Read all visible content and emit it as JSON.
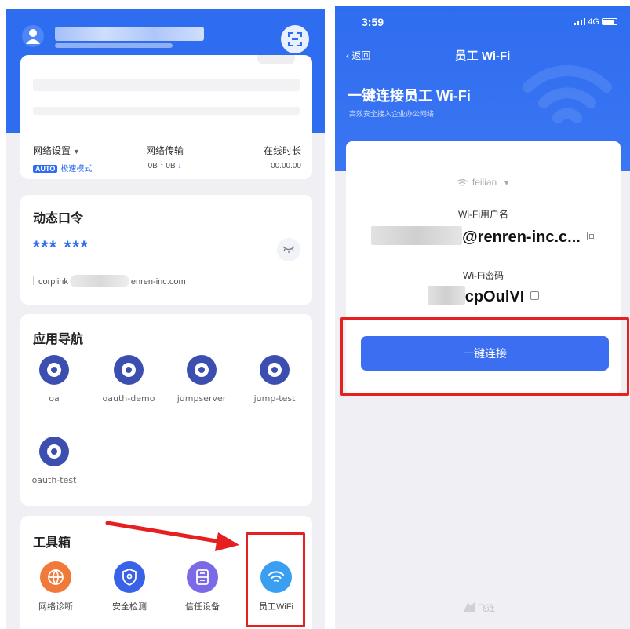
{
  "left_screen": {
    "stats": {
      "network_settings_label": "网络设置",
      "mode_badge": "AUTO",
      "mode_label": "极速模式",
      "transfer_label": "网络传输",
      "upload_value": "0B",
      "download_value": "0B",
      "online_label": "在线时长",
      "online_value": "00.00.00"
    },
    "otp": {
      "title": "动态口令",
      "code": "*** ***",
      "account_prefix": "corplink",
      "account_suffix": "enren-inc.com"
    },
    "apps": {
      "title": "应用导航",
      "items": [
        {
          "label": "oa"
        },
        {
          "label": "oauth-demo"
        },
        {
          "label": "jumpserver"
        },
        {
          "label": "jump-test"
        },
        {
          "label": "oauth-test"
        }
      ]
    },
    "toolbox": {
      "title": "工具箱",
      "items": [
        {
          "label": "网络诊断",
          "icon": "globe-icon",
          "color": "#f07a3a"
        },
        {
          "label": "安全检测",
          "icon": "shield-icon",
          "color": "#3a62e8"
        },
        {
          "label": "信任设备",
          "icon": "device-icon",
          "color": "#7a6ae8"
        },
        {
          "label": "员工WiFi",
          "icon": "wifi-icon",
          "color": "#3a9ff0"
        }
      ]
    }
  },
  "right_screen": {
    "status_time": "3:59",
    "status_network": "4G",
    "back_label": "返回",
    "nav_title": "员工 Wi-Fi",
    "heading": "一键连接员工 Wi-Fi",
    "subheading": "高效安全接入企业办公网络",
    "ssid": "feilian",
    "username_label": "Wi-Fi用户名",
    "username_value": "@renren-inc.c...",
    "password_label": "Wi-Fi密码",
    "password_value": "cpOulVI",
    "connect_button": "一键连接",
    "footer_brand": "飞连"
  },
  "colors": {
    "brand_blue": "#2f6df0",
    "highlight_red": "#e62020"
  }
}
